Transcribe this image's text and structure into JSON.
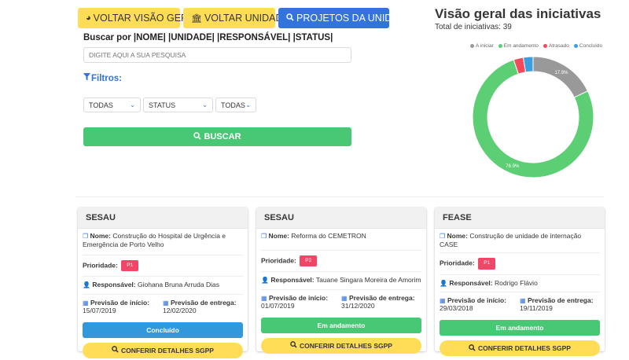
{
  "nav": {
    "btn_overview": "VOLTAR VISÃO GERAL",
    "btn_units": "VOLTAR UNIDADES",
    "btn_projects": "PROJETOS DA UNIDADE"
  },
  "search": {
    "label": "Buscar por |NOME| |UNIDADE| |RESPONSÁVEL| |STATUS|",
    "placeholder": "DIGITE AQUI A SUA PESQUISA",
    "filters_label": "Filtros:",
    "filter1": "TODAS",
    "filter2": "STATUS",
    "filter3": "TODAS",
    "button": "BUSCAR"
  },
  "chart_header": {
    "title": "Visão geral das iniciativas",
    "total": "Total de iniciativas: 39"
  },
  "chart_data": {
    "type": "pie",
    "legend_position": "top",
    "labels": [
      "A iniciar",
      "Em andamento",
      "Atrasado",
      "Concluído"
    ],
    "values": [
      17.9,
      76.9,
      2.6,
      2.6
    ],
    "colors": [
      "#999999",
      "#5ccf75",
      "#f2495c",
      "#3b9ee0"
    ],
    "slice_labels": [
      "17.9%",
      "76.9%",
      "",
      ""
    ]
  },
  "cards": [
    {
      "unit": "SESAU",
      "name_label": "Nome:",
      "name": "Construção do Hospital de Urgência e Emergência de Porto Velho",
      "priority_label": "Prioridade:",
      "priority": "P1",
      "resp_label": "Responsável:",
      "resp": "Giohana Bruna Arruda Dias",
      "start_label": "Previsão de início:",
      "start": "15/07/2019",
      "end_label": "Previsão de entrega:",
      "end": "12/02/2020",
      "status": "Concluído",
      "details": "CONFERIR DETALHES SGPP"
    },
    {
      "unit": "SESAU",
      "name_label": "Nome:",
      "name": "Reforma do CEMETRON",
      "priority_label": "Prioridade:",
      "priority": "P2",
      "resp_label": "Responsável:",
      "resp": "Tauane Singara Moreira de Amorim",
      "start_label": "Previsão de início:",
      "start": "01/07/2019",
      "end_label": "Previsão de entrega:",
      "end": "31/12/2020",
      "status": "Em andamento",
      "details": "CONFERIR DETALHES SGPP"
    },
    {
      "unit": "FEASE",
      "name_label": "Nome:",
      "name": "Construção de unidade de internação CASE",
      "priority_label": "Prioridade:",
      "priority": "P1",
      "resp_label": "Responsável:",
      "resp": "Rodrigo Flávio",
      "start_label": "Previsão de início:",
      "start": "29/03/2018",
      "end_label": "Previsão de entrega:",
      "end": "19/11/2019",
      "status": "Em andamento",
      "details": "CONFERIR DETALHES SGPP"
    }
  ]
}
